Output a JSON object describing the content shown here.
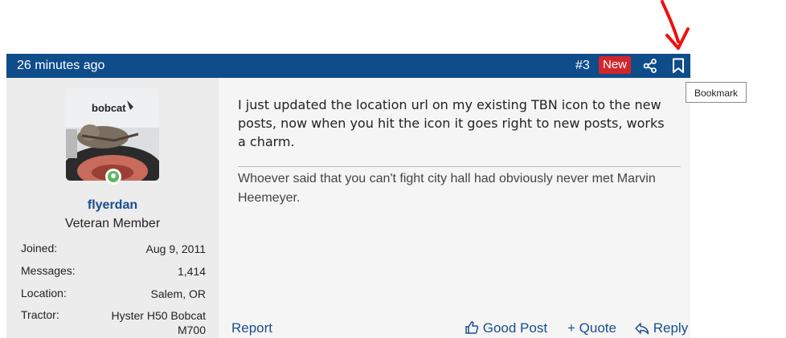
{
  "post": {
    "time": "26 minutes ago",
    "number": "#3",
    "new_badge": "New",
    "header_color": "#0f4c8a",
    "badge_color": "#d2262b",
    "share_icon": "share-icon",
    "bookmark_icon": "bookmark-icon"
  },
  "user": {
    "avatar_logo": "bobcat",
    "username": "flyerdan",
    "title": "Veteran Member",
    "online_status_color": "#5cb85c",
    "stats": [
      {
        "label": "Joined:",
        "value": "Aug 9, 2011"
      },
      {
        "label": "Messages:",
        "value": "1,414"
      },
      {
        "label": "Location:",
        "value": "Salem, OR"
      },
      {
        "label": "Tractor:",
        "value": "Hyster H50 Bobcat M700"
      }
    ]
  },
  "message": {
    "body": "I just updated the location url on my existing TBN icon to the new posts, now when you hit the icon it goes right to new posts, works a charm.",
    "signature": "Whoever said that you can't fight city hall had obviously never met Marvin Heemeyer."
  },
  "actions": {
    "report": "Report",
    "good_post": "Good Post",
    "quote": "+ Quote",
    "reply": "Reply"
  },
  "tooltip": {
    "text": "Bookmark"
  },
  "annotation": {
    "arrow_color": "#ee1111"
  }
}
